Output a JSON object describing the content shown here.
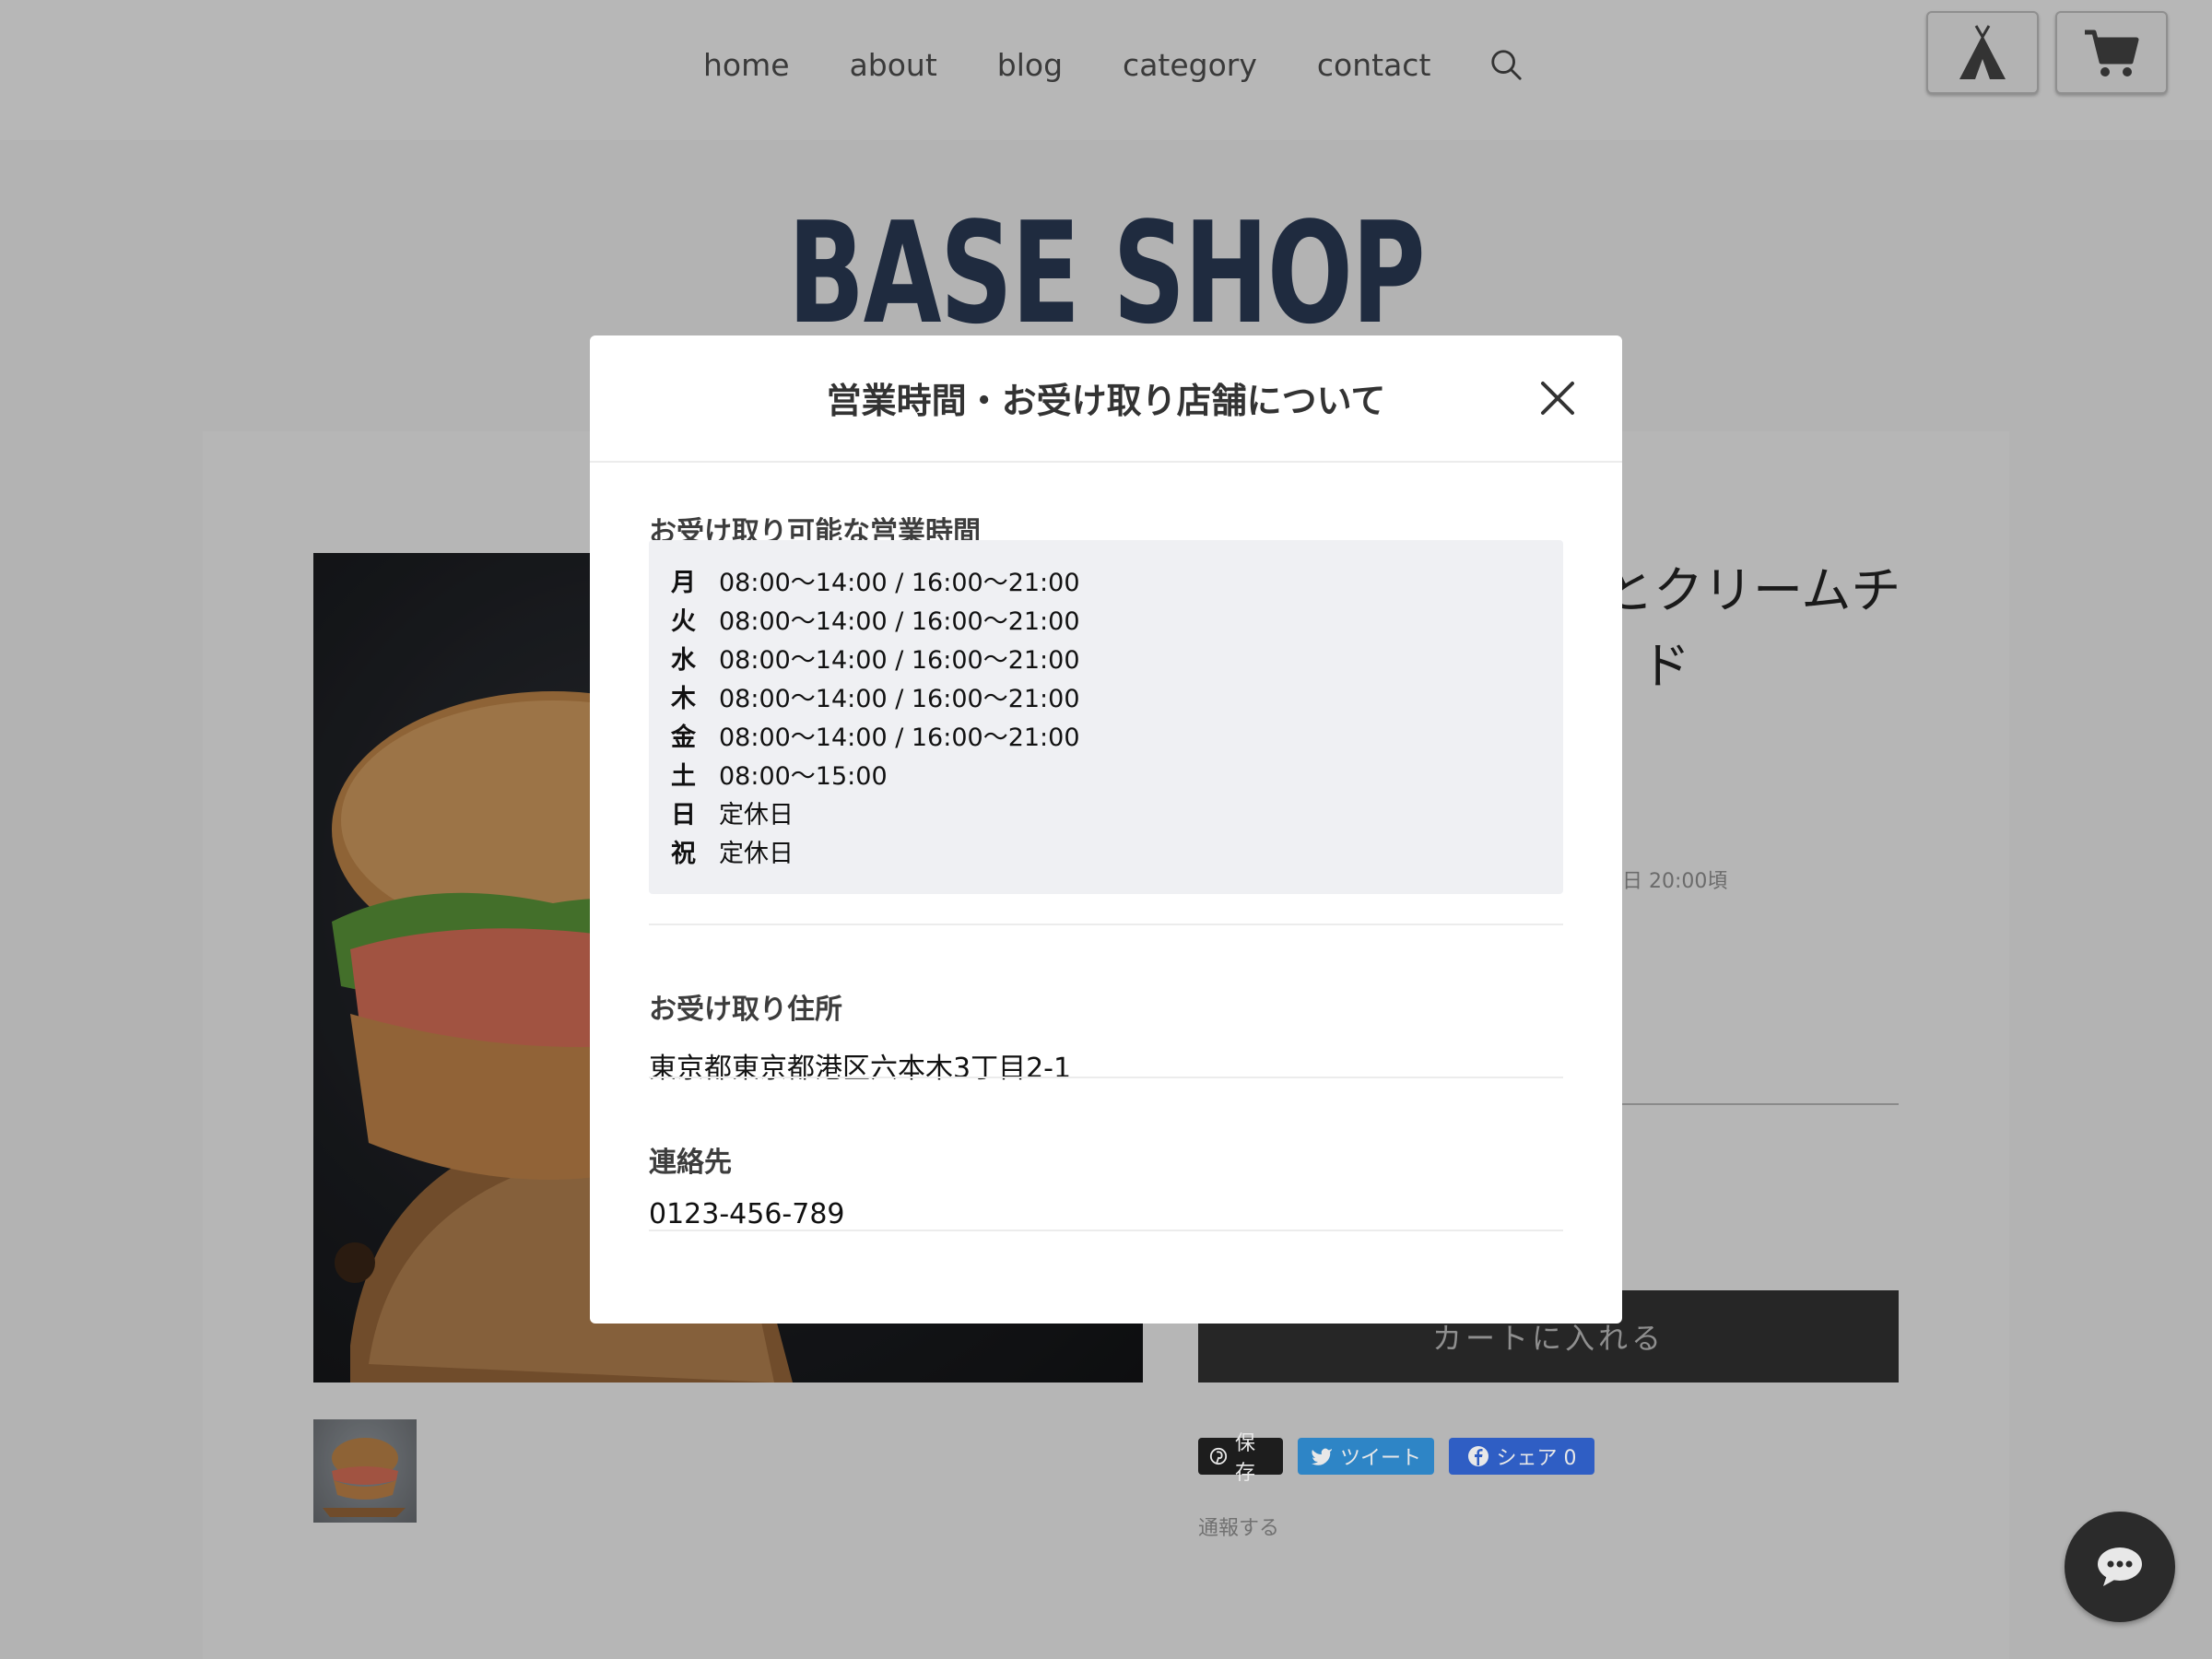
{
  "nav": {
    "items": [
      "home",
      "about",
      "blog",
      "category",
      "contact"
    ]
  },
  "header_icons": [
    "search-icon",
    "tent-icon",
    "cart-icon"
  ],
  "shop": {
    "logo": "BASE SHOP"
  },
  "product": {
    "title_line1": "とクリームチ",
    "title_line2": "ド",
    "delivery_fragment": "日 20:00頃",
    "cart_button": "カートに入れる",
    "share": {
      "pinterest": "保存",
      "twitter": "ツイート",
      "facebook": "シェア 0"
    },
    "report": "通報する"
  },
  "modal": {
    "title": "営業時間・お受け取り店舗について",
    "hours_heading": "お受け取り可能な営業時間",
    "hours": [
      {
        "day": "月",
        "time": "08:00〜14:00 / 16:00〜21:00"
      },
      {
        "day": "火",
        "time": "08:00〜14:00 / 16:00〜21:00"
      },
      {
        "day": "水",
        "time": "08:00〜14:00 / 16:00〜21:00"
      },
      {
        "day": "木",
        "time": "08:00〜14:00 / 16:00〜21:00"
      },
      {
        "day": "金",
        "time": "08:00〜14:00 / 16:00〜21:00"
      },
      {
        "day": "土",
        "time": "08:00〜15:00"
      },
      {
        "day": "日",
        "time": "定休日"
      },
      {
        "day": "祝",
        "time": "定休日"
      }
    ],
    "address_heading": "お受け取り住所",
    "address": "東京都東京都港区六本木3丁目2-1",
    "contact_heading": "連絡先",
    "contact": "0123-456-789"
  },
  "colors": {
    "overlay_bg": "#b3b3b3",
    "logo": "#1f2b3f",
    "modal_bg": "#ffffff",
    "hours_box_bg": "#eff0f3",
    "cart_button_bg": "#262626"
  }
}
